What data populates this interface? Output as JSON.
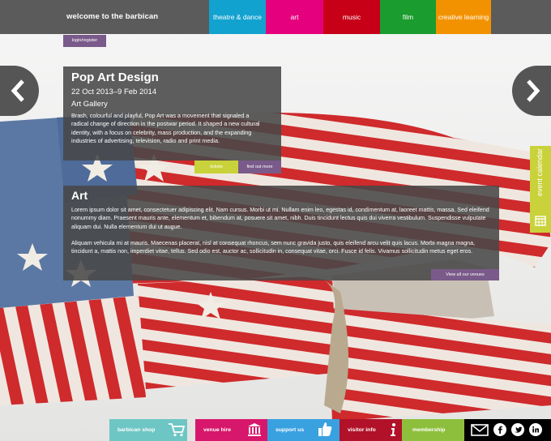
{
  "topbar": {
    "brand": "welcome to the barbican",
    "tabs": [
      {
        "label": "theatre & dance",
        "color": "#12a2cf"
      },
      {
        "label": "art",
        "color": "#e5007e"
      },
      {
        "label": "music",
        "color": "#c70017"
      },
      {
        "label": "film",
        "color": "#1a9c2e"
      },
      {
        "label": "creative learning",
        "color": "#f39200"
      }
    ],
    "login": "login/register"
  },
  "event": {
    "title": "Pop Art Design",
    "dates": "22 Oct 2013–9 Feb 2014",
    "venue": "Art Gallery",
    "description": "Brash, colourful and playful, Pop Art was a movement that signaled a radical change of direction in the postwar period. It shaped a new cultural identity, with a focus on celebrity, mass production, and the expanding industries of advertising, television, radio and print media.",
    "tickets_label": "tickets",
    "find_out_label": "find out more"
  },
  "art": {
    "heading": "Art",
    "paragraph1": "Lorem ipsum dolor sit amet, consectetuer adipiscing elit. Nam cursus. Morbi ut mi. Nullam enim leo, egestas id, condimentum at, laoreet mattis, massa. Sed eleifend nonummy diam. Praesent mauris ante, elementum et, bibendum at, posuere sit amet, nibh. Duis tincidunt lectus quis dui viverra vestibulum. Suspendisse vulputate aliquam dui. Nulla elementum dui ut augue.",
    "paragraph2": "Aliquam vehicula mi at mauris. Maecenas placerat, nisl at consequat rhoncus, sem nunc gravida justo, quis eleifend arcu velit quis lacus. Morbi magna magna, tincidunt a, mattis non, imperdiet vitae, tellus. Sed odio est, auctor ac, sollicitudin in, consequat vitae, orci. Fusce id felis. Vivamus sollicitudin metus eget eros.",
    "venues_label": "View all our venues"
  },
  "calendar": {
    "label": "event calendar",
    "color": "#c9d23a"
  },
  "bottombar": {
    "items": [
      {
        "label": "barbican shop",
        "color": "#6ec6c4",
        "icon": "cart-icon"
      },
      {
        "label": "venue hire",
        "color": "#d7176b",
        "icon": "building-icon"
      },
      {
        "label": "support us",
        "color": "#3aa1e0",
        "icon": "thumbs-up-icon"
      },
      {
        "label": "visitor info",
        "color": "#b11229",
        "icon": "info-icon"
      },
      {
        "label": "membership",
        "color": "#8dbf3c",
        "icon": ""
      }
    ],
    "social": [
      "mail-icon",
      "facebook-icon",
      "twitter-icon",
      "linkedin-icon"
    ]
  }
}
